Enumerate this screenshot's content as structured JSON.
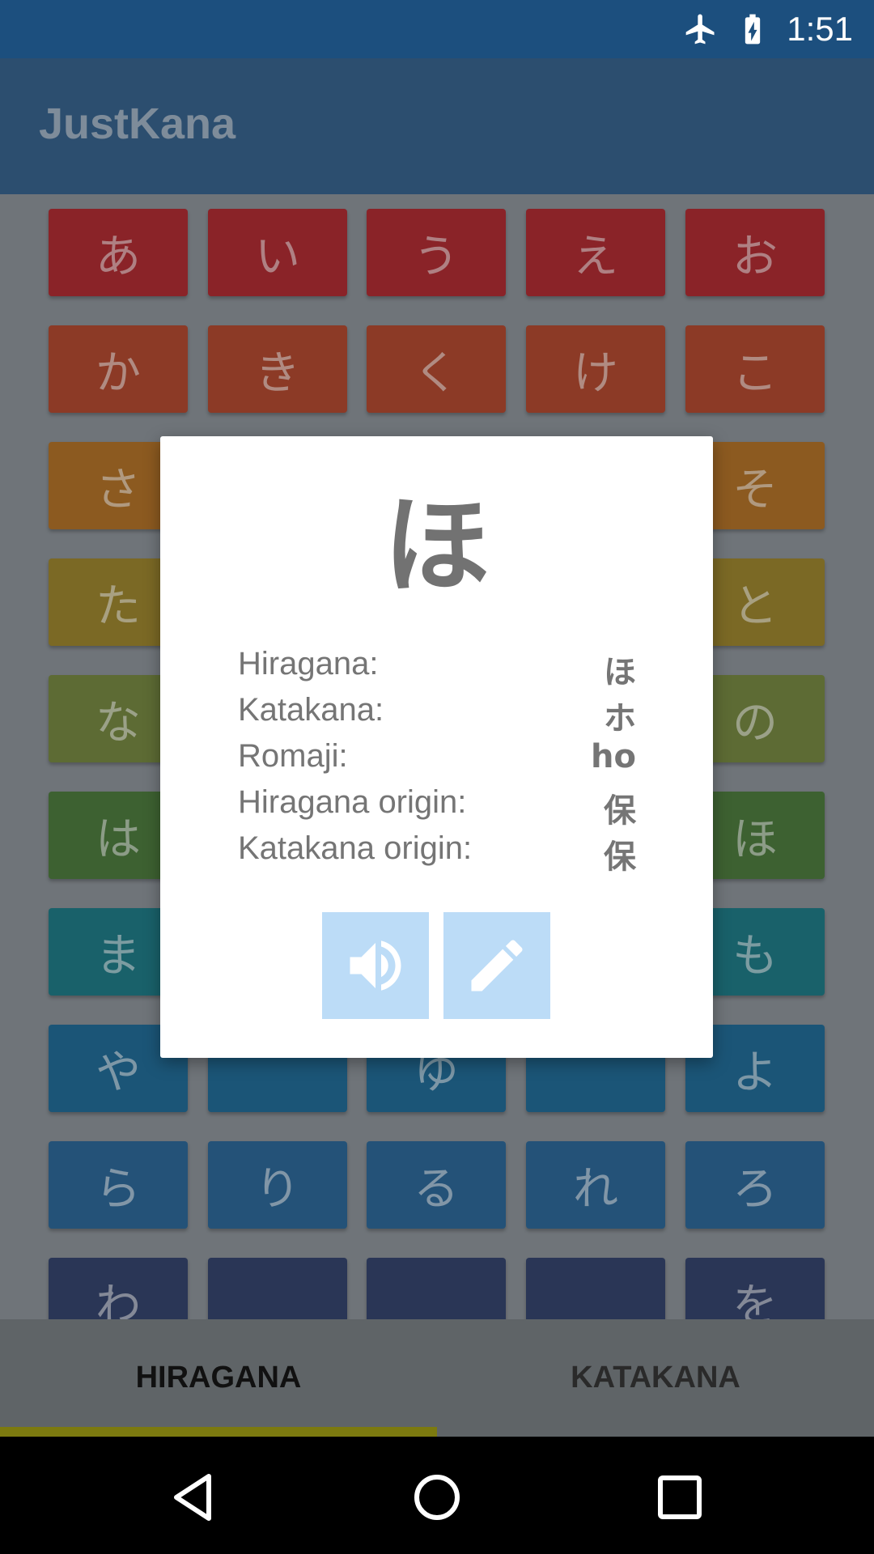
{
  "status_bar": {
    "time": "1:51",
    "icons": [
      "airplane-mode-icon",
      "battery-charging-icon"
    ]
  },
  "app_bar": {
    "title": "JustKana"
  },
  "kana_grid": {
    "rows": [
      {
        "color": "#8a2328",
        "tiles": [
          "あ",
          "い",
          "う",
          "え",
          "お"
        ]
      },
      {
        "color": "#8c3a26",
        "tiles": [
          "か",
          "き",
          "く",
          "け",
          "こ"
        ]
      },
      {
        "color": "#8c5a20",
        "tiles": [
          "さ",
          "",
          "",
          "",
          "そ"
        ]
      },
      {
        "color": "#7b6925",
        "tiles": [
          "た",
          "",
          "",
          "",
          "と"
        ]
      },
      {
        "color": "#5d6b34",
        "tiles": [
          "な",
          "",
          "",
          "",
          "の"
        ]
      },
      {
        "color": "#3d6131",
        "tiles": [
          "は",
          "",
          "",
          "",
          "ほ"
        ]
      },
      {
        "color": "#19616a",
        "tiles": [
          "ま",
          "",
          "",
          "",
          "も"
        ]
      },
      {
        "color": "#1b5577",
        "tiles": [
          "や",
          "",
          "ゆ",
          "",
          "よ"
        ]
      },
      {
        "color": "#245278",
        "tiles": [
          "ら",
          "り",
          "る",
          "れ",
          "ろ"
        ]
      },
      {
        "color": "#2a3656",
        "tiles": [
          "わ",
          "",
          "",
          "",
          "を"
        ]
      }
    ]
  },
  "tabs": {
    "hiragana": "HIRAGANA",
    "katakana": "KATAKANA",
    "selected": "HIRAGANA",
    "indicator_color": "#7c7a0f"
  },
  "dialog": {
    "kana": "ほ",
    "rows": [
      {
        "label": "Hiragana:",
        "value": "ほ"
      },
      {
        "label": "Katakana:",
        "value": "ホ"
      },
      {
        "label": "Romaji:",
        "value": "ho"
      },
      {
        "label": "Hiragana origin:",
        "value": "保"
      },
      {
        "label": "Katakana origin:",
        "value": "保"
      }
    ],
    "buttons": [
      "speaker-icon",
      "pencil-icon"
    ],
    "button_color": "#bcdcf7"
  },
  "nav_bar": {
    "icons": [
      "back-icon",
      "home-icon",
      "recents-icon"
    ]
  }
}
